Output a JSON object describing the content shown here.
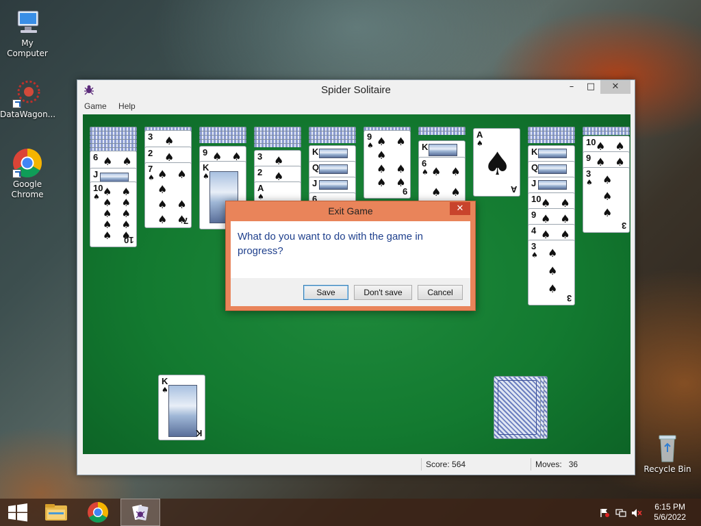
{
  "desktop": {
    "icons": [
      {
        "label": "My Computer"
      },
      {
        "label": "DataWagon..."
      },
      {
        "label": "Google Chrome"
      },
      {
        "label": "Recycle Bin"
      }
    ]
  },
  "window": {
    "title": "Spider Solitaire",
    "controls": {
      "minimize": "–",
      "maximize": "□",
      "close": "✕"
    },
    "menu": [
      "Game",
      "Help"
    ],
    "status": {
      "score": "Score: 564",
      "moves_label": "Moves:",
      "moves_value": "36"
    }
  },
  "tableau": {
    "columns": [
      {
        "hidden": 6,
        "visible": [
          "6",
          "J",
          "10"
        ]
      },
      {
        "hidden": 1,
        "visible": [
          "3",
          "2",
          "7"
        ]
      },
      {
        "hidden": 4,
        "visible": [
          "9",
          "K"
        ]
      },
      {
        "hidden": 5,
        "visible": [
          "3",
          "2",
          "A"
        ]
      },
      {
        "hidden": 5,
        "visible": [
          "K",
          "Q",
          "J",
          "6"
        ]
      },
      {
        "hidden": 1,
        "visible": [
          "9"
        ]
      },
      {
        "hidden": 2,
        "visible": [
          "K",
          "6"
        ]
      },
      {
        "hidden": 0,
        "visible": [
          "A"
        ]
      },
      {
        "hidden": 4,
        "visible": [
          "K",
          "Q",
          "J",
          "10",
          "9",
          "4",
          "3"
        ]
      },
      {
        "hidden": 2,
        "visible": [
          "10",
          "9",
          "3"
        ]
      }
    ],
    "foundation": {
      "top_card": "K"
    },
    "stock": {
      "piles": 3
    }
  },
  "dialog": {
    "title": "Exit Game",
    "message": "What do you want to do with the game in progress?",
    "buttons": {
      "save": "Save",
      "dont_save": "Don't save",
      "cancel": "Cancel"
    },
    "close": "✕"
  },
  "taskbar": {
    "time": "6:15 PM",
    "date": "5/6/2022"
  },
  "colors": {
    "felt": "#137a30",
    "dialog_frame": "#e9845a",
    "message_text": "#1e3f8c"
  }
}
